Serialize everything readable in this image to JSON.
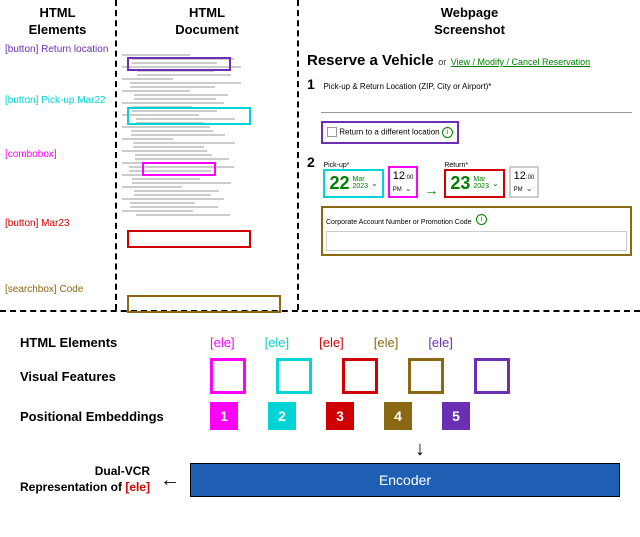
{
  "columns": {
    "col1_header": "HTML\nElements",
    "col2_header": "HTML\nDocument",
    "col3_header": "Webpage\nScreenshot"
  },
  "html_elements": {
    "purple": "[button] Return location",
    "teal": "[button] Pick-up Mar22",
    "magenta": "[combobox]",
    "red": "[button] Mar23",
    "brown": "[searchbox] Code"
  },
  "webpage": {
    "title": "Reserve a Vehicle",
    "or": "or",
    "link": "View / Modify / Cancel Reservation",
    "pickup_return_label": "Pick-up & Return Location (ZIP, City or Airport)*",
    "return_diff": "Return to a different location",
    "pickup_label": "Pick-up*",
    "return_label": "Return*",
    "pickup_day": "22",
    "pickup_month": "Mar",
    "pickup_year": "2023",
    "pickup_time": "12",
    "pickup_mins": ":00",
    "pickup_ampm": "PM",
    "return_day": "23",
    "return_month": "Mar",
    "return_year": "2023",
    "return_time": "12",
    "return_mins": ":00",
    "return_ampm": "PM",
    "corp_label": "Corporate Account Number or Promotion Code",
    "step1": "1",
    "step2": "2",
    "info": "i"
  },
  "bottom": {
    "row1_label": "HTML Elements",
    "row2_label": "Visual Features",
    "row3_label": "Positional Embeddings",
    "ele": "[ele]",
    "pos": [
      "1",
      "2",
      "3",
      "4",
      "5"
    ],
    "output_label1": "Dual-VCR",
    "output_label2": "Representation of ",
    "encoder": "Encoder"
  },
  "colors": {
    "magenta": "#ff00ff",
    "teal": "#00d4d4",
    "red": "#d00000",
    "brown": "#8b6914",
    "purple": "#6b2fb3"
  }
}
